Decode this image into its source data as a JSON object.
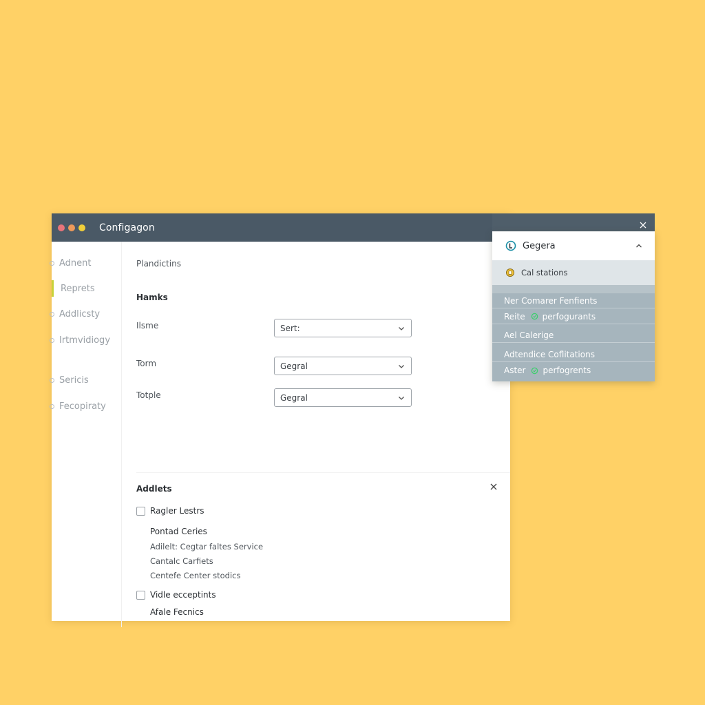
{
  "window": {
    "title": "Configagon"
  },
  "sidebar": {
    "items": [
      {
        "label": "Adnent"
      },
      {
        "label": "Reprets"
      },
      {
        "label": "Addlicsty"
      },
      {
        "label": "Irtmvidiogy"
      },
      {
        "label": "Sericis"
      },
      {
        "label": "Fecopiraty"
      }
    ]
  },
  "content": {
    "breadcrumb": "Plandictins",
    "section_title": "Hamks",
    "fields": [
      {
        "label": "Ilsme",
        "value": "Sert:"
      },
      {
        "label": "Torm",
        "value": "Gegral"
      },
      {
        "label": "Totple",
        "value": "Gegral"
      }
    ],
    "addlets": {
      "title": "Addlets",
      "checkbox_1": "Ragler Lestrs",
      "group_head": "Pontad Ceries",
      "lines": [
        "Adilelt: Cegtar faltes Service",
        "Cantalc Carfiets",
        "Centefe Center stodics"
      ],
      "checkbox_2": "Vidle ecceptints",
      "footer_head": "Afale Fecnics"
    }
  },
  "popover": {
    "title": "Gegera",
    "selected": "Cal stations",
    "items": [
      {
        "label": "Ner Comarer Fenfients"
      },
      {
        "label": "Reite",
        "suffix": "perfogurants"
      },
      {
        "label": "Ael Calerige"
      },
      {
        "label": "Adtendice Coflitations"
      },
      {
        "label": "Aster",
        "suffix": "perfogrents"
      }
    ]
  },
  "colors": {
    "background": "#FFD166",
    "titlebar": "#4a5966",
    "accent_bar": "#c8d23a",
    "popover_list": "#a6b5bd",
    "popover_selected": "#dfe5e8"
  }
}
